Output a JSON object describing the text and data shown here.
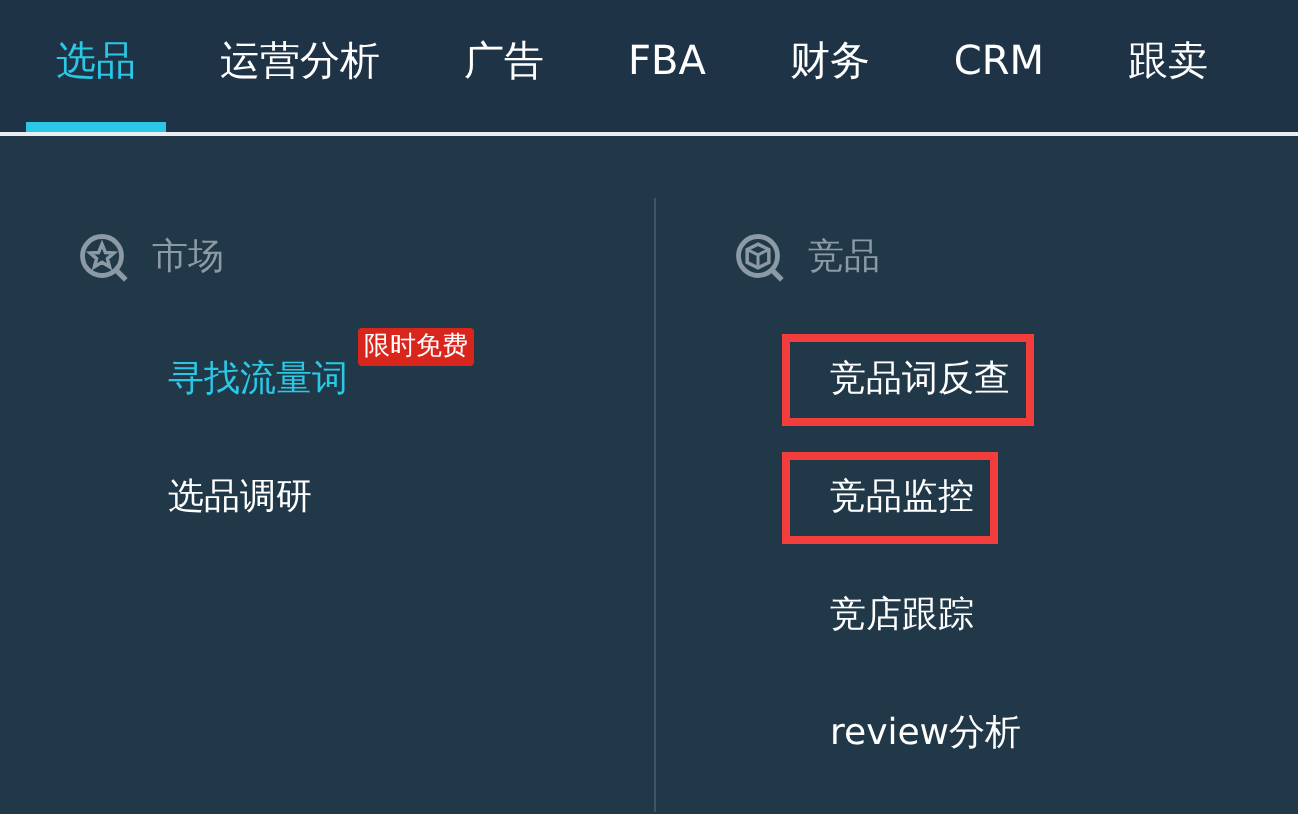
{
  "tabs": [
    {
      "label": "选品",
      "selected": true
    },
    {
      "label": "运营分析",
      "selected": false
    },
    {
      "label": "广告",
      "selected": false
    },
    {
      "label": "FBA",
      "selected": false
    },
    {
      "label": "财务",
      "selected": false
    },
    {
      "label": "CRM",
      "selected": false
    },
    {
      "label": "跟卖",
      "selected": false
    }
  ],
  "columns": [
    {
      "title": "市场",
      "items": [
        {
          "label": "寻找流量词",
          "selected": true,
          "highlighted": false,
          "badge": "限时免费"
        },
        {
          "label": "选品调研",
          "selected": false,
          "highlighted": false
        }
      ]
    },
    {
      "title": "竞品",
      "items": [
        {
          "label": "竞品词反查",
          "selected": false,
          "highlighted": true
        },
        {
          "label": "竞品监控",
          "selected": false,
          "highlighted": true
        },
        {
          "label": "竞店跟踪",
          "selected": false,
          "highlighted": false
        },
        {
          "label": "review分析",
          "selected": false,
          "highlighted": false
        }
      ]
    }
  ]
}
